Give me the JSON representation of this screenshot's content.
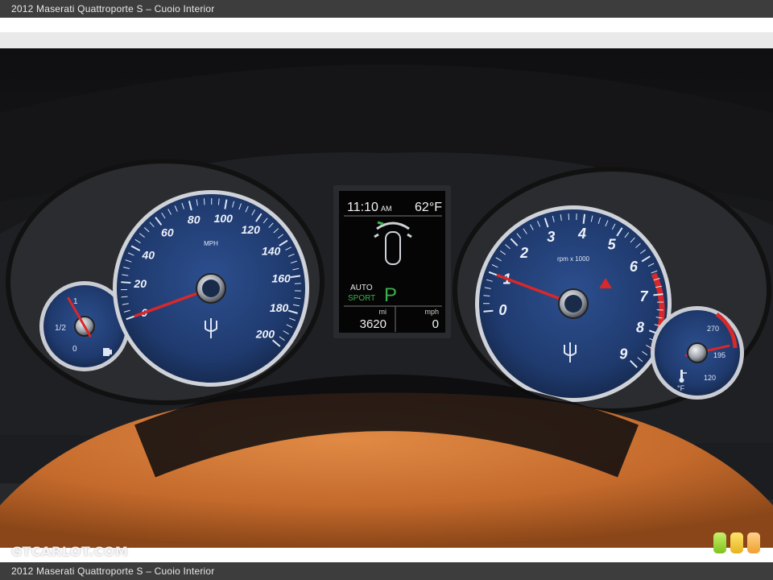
{
  "caption": {
    "top": "2012 Maserati Quattroporte S – Cuoio Interior",
    "bottom": "2012 Maserati Quattroporte S – Cuoio Interior"
  },
  "watermark": "GTCARLOT.COM",
  "colors": {
    "gauge_face": "#1f3a6e",
    "needle": "#d8282a",
    "leather": "#c46a2c",
    "bezel": "#c9ccd2"
  },
  "info_display": {
    "time": "11:10",
    "ampm": "AM",
    "temperature": "62°F",
    "mode_line1": "AUTO",
    "mode_line2": "SPORT",
    "gear": "P",
    "odo_label": "mi",
    "odo_value": "3620",
    "speed_label": "mph",
    "speed_value": "0"
  },
  "speedometer": {
    "unit": "MPH",
    "ticks": [
      "0",
      "20",
      "40",
      "60",
      "80",
      "100",
      "120",
      "140",
      "160",
      "180",
      "200"
    ],
    "reading": 0
  },
  "tachometer": {
    "unit": "rpm x 1000",
    "ticks": [
      "0",
      "1",
      "2",
      "3",
      "4",
      "5",
      "6",
      "7",
      "8",
      "9"
    ],
    "reading": 1.0
  },
  "fuel_gauge": {
    "ticks": [
      "0",
      "1/2",
      "1"
    ],
    "icon": "fuel-pump-icon"
  },
  "temp_gauge": {
    "ticks": [
      "120",
      "195",
      "270"
    ],
    "unit": "°F",
    "icon": "coolant-temperature-icon"
  },
  "indicator_lights": [
    "green",
    "yellow",
    "orange"
  ]
}
